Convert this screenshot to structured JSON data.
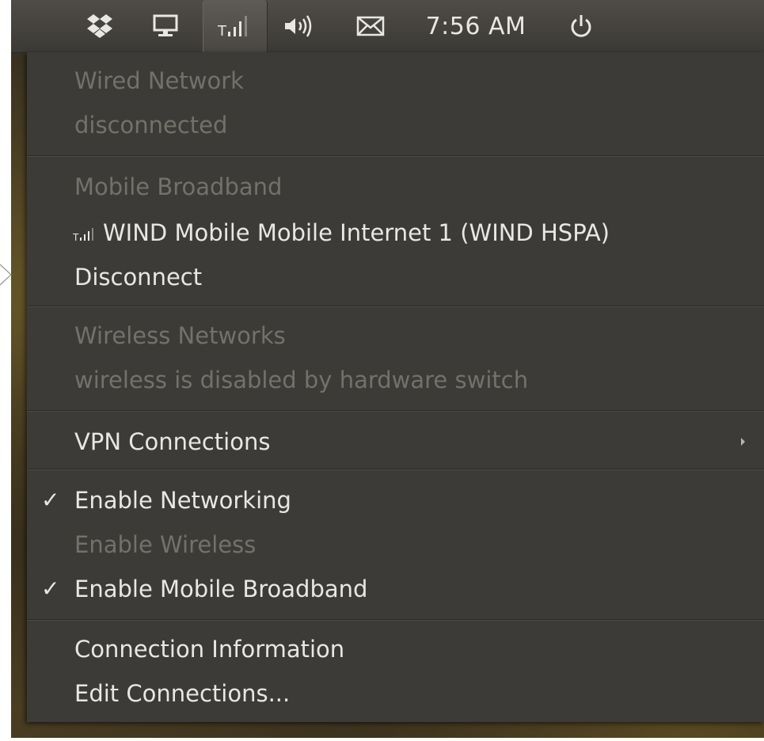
{
  "panel": {
    "icons": [
      {
        "name": "dropbox-icon"
      },
      {
        "name": "display-icon"
      },
      {
        "name": "mobile-signal-icon"
      },
      {
        "name": "volume-icon"
      },
      {
        "name": "mail-icon"
      },
      {
        "name": "power-icon"
      }
    ],
    "clock": "7:56 AM"
  },
  "menu": {
    "wired_header": "Wired Network",
    "wired_status": "disconnected",
    "mobile_header": "Mobile Broadband",
    "mobile_connection": "WIND Mobile Mobile Internet 1 (WIND HSPA)",
    "mobile_disconnect": "Disconnect",
    "wireless_header": "Wireless Networks",
    "wireless_status": "wireless is disabled by hardware switch",
    "vpn": "VPN Connections",
    "enable_networking": "Enable Networking",
    "enable_wireless": "Enable Wireless",
    "enable_mobile": "Enable Mobile Broadband",
    "connection_info": "Connection Information",
    "edit_connections": "Edit Connections..."
  },
  "colors": {
    "menu_bg": "#3c3b37",
    "text_enabled": "#e9e7e3",
    "text_disabled": "#74716b"
  }
}
